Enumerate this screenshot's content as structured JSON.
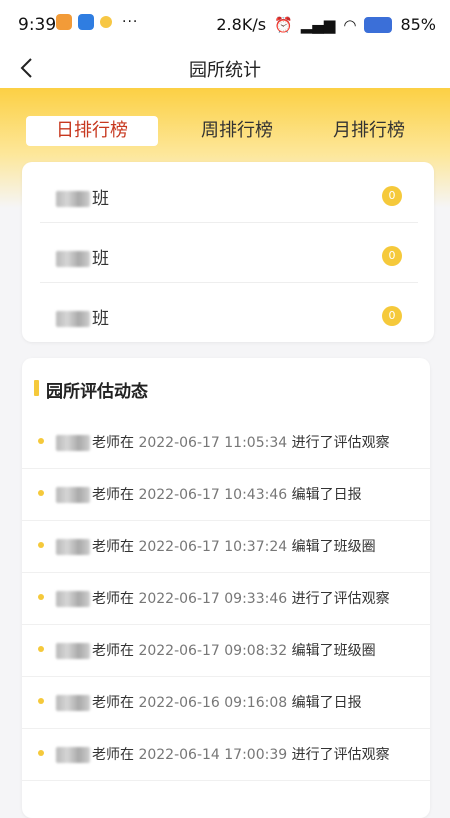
{
  "status_bar": {
    "time": "9:39",
    "dots": "···",
    "network_speed": "2.8K/s",
    "battery": "85%"
  },
  "nav": {
    "title": "园所统计"
  },
  "tabs": [
    {
      "label": "日排行榜",
      "active": true
    },
    {
      "label": "周排行榜",
      "active": false
    },
    {
      "label": "月排行榜",
      "active": false
    }
  ],
  "ranking": [
    {
      "name_suffix": "班",
      "count": "0"
    },
    {
      "name_suffix": "班",
      "count": "0"
    },
    {
      "name_suffix": "班",
      "count": "0"
    }
  ],
  "activity": {
    "title": "园所评估动态",
    "items": [
      {
        "role": "老师在",
        "time": "2022-06-17 11:05:34",
        "action": "进行了评估观察"
      },
      {
        "role": "老师在",
        "time": "2022-06-17 10:43:46",
        "action": "编辑了日报"
      },
      {
        "role": "老师在",
        "time": "2022-06-17 10:37:24",
        "action": "编辑了班级圈"
      },
      {
        "role": "老师在",
        "time": "2022-06-17 09:33:46",
        "action": "进行了评估观察"
      },
      {
        "role": "老师在",
        "time": "2022-06-17 09:08:32",
        "action": "编辑了班级圈"
      },
      {
        "role": "老师在",
        "time": "2022-06-16 09:16:08",
        "action": "编辑了日报"
      },
      {
        "role": "老师在",
        "time": "2022-06-14 17:00:39",
        "action": "进行了评估观察"
      }
    ]
  },
  "colors": {
    "accent_yellow": "#f5c93b",
    "active_tab_text": "#c7381f"
  }
}
